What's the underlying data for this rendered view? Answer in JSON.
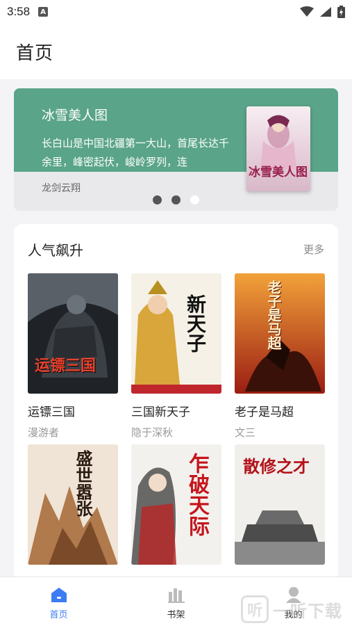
{
  "status": {
    "time": "3:58",
    "a_badge": "A"
  },
  "header": {
    "title": "首页"
  },
  "banner": {
    "title": "冰雪美人图",
    "description": "长白山是中国北疆第一大山，首尾长达千余里，峰密起伏，峻岭罗列，连",
    "author": "龙剑云翔",
    "cover_title": "冰雪美人图",
    "dots": 3,
    "active_dot": 2
  },
  "popular": {
    "title": "人气飙升",
    "more": "更多",
    "books": [
      {
        "title": "运镖三国",
        "author": "漫游者",
        "cover_text": "运镖三国"
      },
      {
        "title": "三国新天子",
        "author": "隐于深秋",
        "cover_text": "新天子"
      },
      {
        "title": "老子是马超",
        "author": "文三",
        "cover_text": "老子是马超"
      },
      {
        "title": "盛世嚣张",
        "author": "",
        "cover_text": "盛世嚣张"
      },
      {
        "title": "乍破天际",
        "author": "",
        "cover_text": "乍破天际"
      },
      {
        "title": "散修之才之我",
        "author": "",
        "cover_text": "散修之才"
      }
    ]
  },
  "nav": {
    "items": [
      {
        "label": "首页",
        "icon": "home-icon",
        "active": true
      },
      {
        "label": "书架",
        "icon": "bookshelf-icon",
        "active": false
      },
      {
        "label": "我的",
        "icon": "profile-icon",
        "active": false
      }
    ]
  },
  "watermark": {
    "box": "听",
    "text": "一听下载"
  },
  "colors": {
    "banner_green": "#5aa489",
    "accent_blue": "#3d7cf2"
  }
}
